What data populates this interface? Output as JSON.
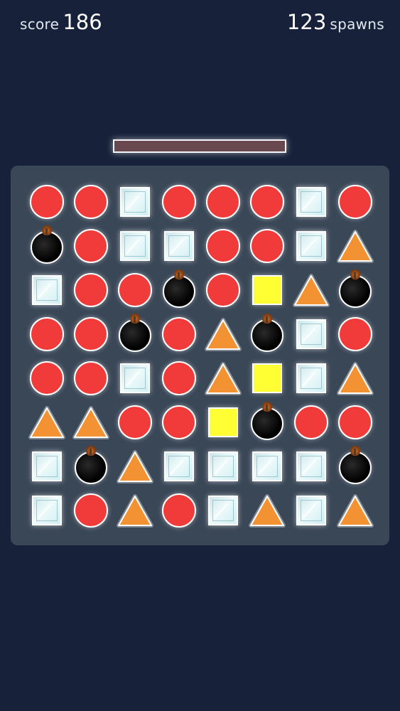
{
  "hud": {
    "score_label": "score",
    "score_value": "186",
    "spawns_value": "123",
    "spawns_label": "spawns"
  },
  "timer": {
    "fill_fraction": 1.0
  },
  "colors": {
    "background": "#17223a",
    "board": "#3a4757",
    "circle": "#f13b3b",
    "square": "#ffff33",
    "triangle": "#f29232",
    "ice": "#dff4f6",
    "bomb": "#000000",
    "timer_fill": "#6a4850"
  },
  "board": {
    "rows": 8,
    "cols": 8,
    "grid": [
      [
        "circle",
        "circle",
        "ice",
        "circle",
        "circle",
        "circle",
        "ice",
        "circle"
      ],
      [
        "bomb",
        "circle",
        "ice",
        "ice",
        "circle",
        "circle",
        "ice",
        "triangle"
      ],
      [
        "ice",
        "circle",
        "circle",
        "bomb",
        "circle",
        "square",
        "triangle",
        "bomb"
      ],
      [
        "circle",
        "circle",
        "bomb",
        "circle",
        "triangle",
        "bomb",
        "ice",
        "circle"
      ],
      [
        "circle",
        "circle",
        "ice",
        "circle",
        "triangle",
        "square",
        "ice",
        "triangle"
      ],
      [
        "triangle",
        "triangle",
        "circle",
        "circle",
        "square",
        "bomb",
        "circle",
        "circle"
      ],
      [
        "ice",
        "bomb",
        "triangle",
        "ice",
        "ice",
        "ice",
        "ice",
        "bomb"
      ],
      [
        "ice",
        "circle",
        "triangle",
        "circle",
        "ice",
        "triangle",
        "ice",
        "triangle"
      ]
    ]
  }
}
